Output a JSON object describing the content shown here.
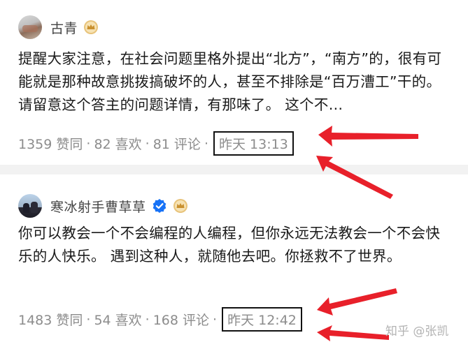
{
  "posts": [
    {
      "author": "古青",
      "verified": false,
      "text": "提醒大家注意，在社会问题里格外提出“北方”，“南方”的，很有可能就是那种故意挑拨搞破坏的人，甚至不排除是“百万漕工”干的。请留意这个答主的问题详情，有那味了。 这个不…",
      "likes": "1359 赞同",
      "favorites": "82 喜欢",
      "comments": "81 评论",
      "time": "昨天 13:13"
    },
    {
      "author": "寒冰射手曹草草",
      "verified": true,
      "text": "你可以教会一个不会编程的人编程，但你永远无法教会一个不会快乐的人快乐。 遇到这种人，就随他去吧。你拯救不了世界。",
      "likes": "1483 赞同",
      "favorites": "54 喜欢",
      "comments": "168 评论",
      "time": "昨天 12:42"
    }
  ],
  "separator": "·",
  "watermark": "知乎 @张凯",
  "colors": {
    "arrow": "#e8202a",
    "meta": "#8c8c8c",
    "verified": "#1772f6",
    "badge": "#e8c37a"
  },
  "icons": {
    "badge": "crown-badge-icon",
    "verified": "verified-check-icon"
  }
}
